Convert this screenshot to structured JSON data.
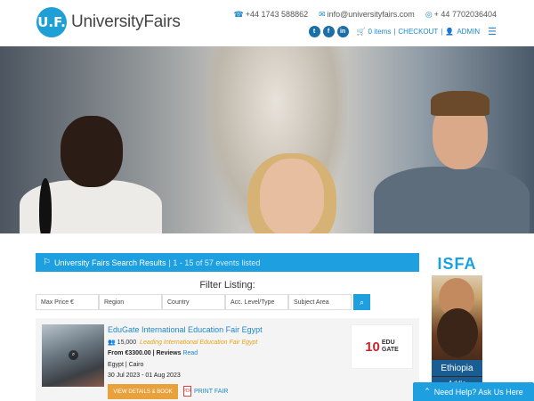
{
  "header": {
    "logo_mark": "U.F.",
    "logo_text_1": "University",
    "logo_text_2": "Fairs",
    "phone": "+44 1743 588862",
    "email": "info@universityfairs.com",
    "whatsapp": "+ 44 7702036404",
    "cart": "0 items",
    "checkout": "CHECKOUT",
    "admin": "ADMIN",
    "social": [
      "t",
      "f",
      "in"
    ]
  },
  "results": {
    "title": "University Fairs Search Results",
    "count": "| 1 - 15 of 57 events listed"
  },
  "filters": {
    "title": "Filter Listing:",
    "fields": [
      "Max Price €",
      "Region",
      "Country",
      "Acc. Level/Type",
      "Subject Area"
    ]
  },
  "fair": {
    "title": "EduGate International Education Fair Egypt",
    "visitors": "15,000",
    "lead": "Leading International Education Fair Egypt",
    "price": "From €3300.00 | Reviews",
    "read": "Read",
    "location": "Egypt | Cairo",
    "dates": "30 Jul 2023 - 01 Aug 2023",
    "book_label": "VIEW DETAILS & BOOK",
    "print_label": "PRINT FAIR",
    "logo_num": "10",
    "logo_word_1": "EDU",
    "logo_word_2": "GATE"
  },
  "ad": {
    "brand": "ISFA",
    "country": "Ethiopia",
    "city": "Addis"
  },
  "help": {
    "label": "Need Help? Ask Us Here"
  },
  "colors": {
    "accent": "#1e9fe0",
    "book": "#e9a13b",
    "lead": "#e8a31a"
  }
}
